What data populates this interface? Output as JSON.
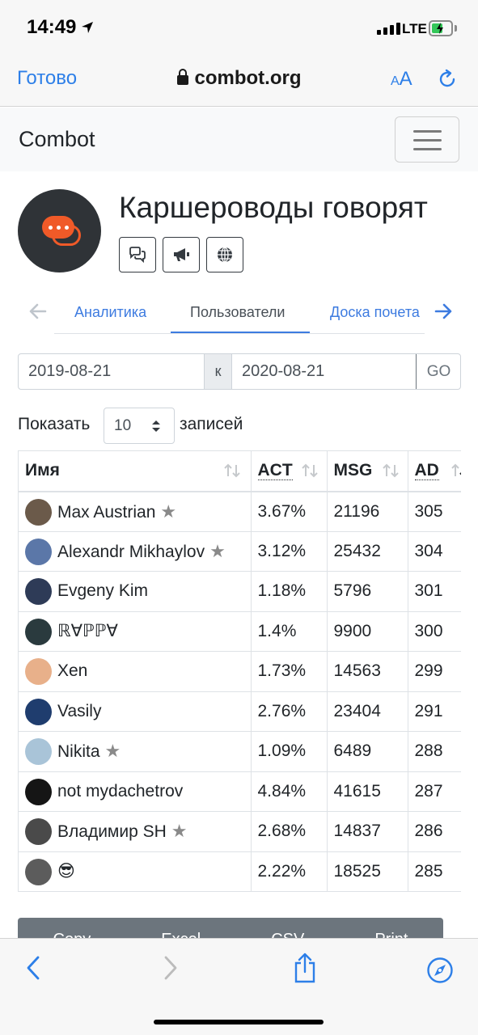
{
  "status": {
    "time": "14:49",
    "network": "LTE"
  },
  "browser": {
    "done_label": "Готово",
    "url": "combot.org",
    "text_size_label": "A",
    "text_size_small": "A"
  },
  "navbar": {
    "brand": "Combot"
  },
  "group": {
    "title": "Каршероводы говорят"
  },
  "tabs": [
    {
      "label": "Аналитика"
    },
    {
      "label": "Пользователи"
    },
    {
      "label": "Доска почета"
    }
  ],
  "filter": {
    "date_from": "2019-08-21",
    "separator": "к",
    "date_to": "2020-08-21",
    "go_label": "GO"
  },
  "entries": {
    "prefix": "Показать",
    "value": "10",
    "suffix": "записей"
  },
  "table": {
    "columns": [
      "Имя",
      "ACT",
      "MSG",
      "AD"
    ],
    "rows": [
      {
        "name": "Max Austrian",
        "starred": true,
        "act": "3.67%",
        "msg": "21196",
        "ad": "305",
        "avatar_color": "#6b5a4a"
      },
      {
        "name": "Alexandr Mikhaylov",
        "starred": true,
        "act": "3.12%",
        "msg": "25432",
        "ad": "304",
        "avatar_color": "#5b77a8"
      },
      {
        "name": "Evgeny Kim",
        "starred": false,
        "act": "1.18%",
        "msg": "5796",
        "ad": "301",
        "avatar_color": "#2e3b57"
      },
      {
        "name": "ℝ∀ℙℙ∀",
        "starred": false,
        "act": "1.4%",
        "msg": "9900",
        "ad": "300",
        "avatar_color": "#2a3a3e"
      },
      {
        "name": "Xen",
        "starred": false,
        "act": "1.73%",
        "msg": "14563",
        "ad": "299",
        "avatar_color": "#e8b08a"
      },
      {
        "name": "Vasily",
        "starred": false,
        "act": "2.76%",
        "msg": "23404",
        "ad": "291",
        "avatar_color": "#1f3d6e"
      },
      {
        "name": "Nikita",
        "starred": true,
        "act": "1.09%",
        "msg": "6489",
        "ad": "288",
        "avatar_color": "#a9c4d8"
      },
      {
        "name": "not mydachetrov",
        "starred": false,
        "act": "4.84%",
        "msg": "41615",
        "ad": "287",
        "avatar_color": "#151515"
      },
      {
        "name": "Владимир SH",
        "starred": true,
        "act": "2.68%",
        "msg": "14837",
        "ad": "286",
        "avatar_color": "#4a4a4a"
      },
      {
        "name": "😎",
        "starred": false,
        "act": "2.22%",
        "msg": "18525",
        "ad": "285",
        "avatar_color": "#5c5c5c"
      }
    ]
  },
  "export_buttons": [
    "Copy",
    "Excel",
    "CSV",
    "Print"
  ],
  "colors": {
    "link": "#3d7be0",
    "ios_blue": "#2d7fe8",
    "star": "#8a8a8a",
    "battery": "#34c759"
  }
}
